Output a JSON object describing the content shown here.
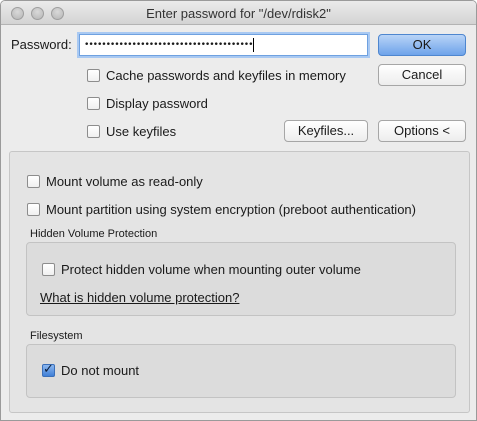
{
  "window": {
    "title": "Enter password for \"/dev/rdisk2\""
  },
  "password": {
    "label": "Password:",
    "value": "•••••••••••••••••••••••••••••••••••••••"
  },
  "buttons": {
    "ok": "OK",
    "cancel": "Cancel",
    "keyfiles": "Keyfiles...",
    "options": "Options <"
  },
  "checkboxes": {
    "cache": {
      "label": "Cache passwords and keyfiles in memory",
      "checked": false
    },
    "display_password": {
      "label": "Display password",
      "checked": false
    },
    "use_keyfiles": {
      "label": "Use keyfiles",
      "checked": false
    },
    "read_only": {
      "label": "Mount volume as read-only",
      "checked": false
    },
    "system_encryption": {
      "label": "Mount partition using system encryption (preboot authentication)",
      "checked": false
    }
  },
  "hidden_volume": {
    "title": "Hidden Volume Protection",
    "protect": {
      "label": "Protect hidden volume when mounting outer volume",
      "checked": false
    },
    "link": "What is hidden volume protection?"
  },
  "filesystem": {
    "title": "Filesystem",
    "do_not_mount": {
      "label": "Do not mount",
      "checked": true
    }
  }
}
